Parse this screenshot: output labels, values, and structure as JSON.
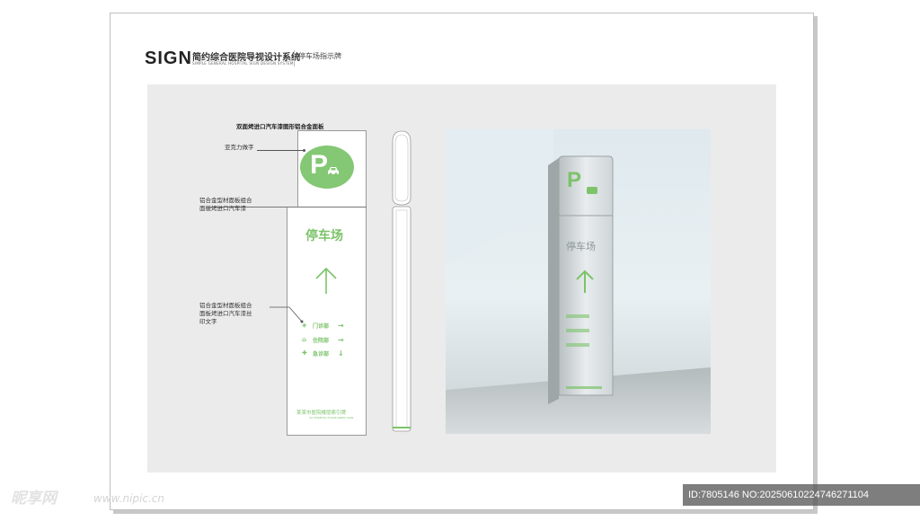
{
  "header": {
    "sign_word": "SIGN",
    "title_cn": "简约综合医院导视设计系统",
    "title_en": "SIMPLE GENERAL HOSPITAL SIGN DESIGN SYSTEM",
    "subtitle": "停车场指示牌"
  },
  "drawing": {
    "title": "双面烤进口汽车漆图形铝合金面板",
    "p_letter": "P",
    "main_text": "停车场",
    "directions": [
      {
        "icon": "outpatient-icon",
        "label": "门诊部",
        "arrow": "→"
      },
      {
        "icon": "inpatient-icon",
        "label": "住院部",
        "arrow": "→"
      },
      {
        "icon": "emergency-icon",
        "label": "急诊部",
        "arrow": "↓"
      }
    ],
    "footer_cn": "某某市医院楼层索引牌",
    "footer_en": "XX HOSPITAL FLOOR INDEX SIGN",
    "annotations": {
      "acrylic": "亚克力做字",
      "panel_line1": "铝合金型材面板组合",
      "panel_line2": "面板烤进口汽车漆",
      "print_line1": "铝合金型材面板组合",
      "print_line2": "面板烤进口汽车漆丝",
      "print_line3": "印文字"
    }
  },
  "colors": {
    "accent": "#7cc36a",
    "board": "#ebebeb"
  },
  "watermark": {
    "brand": "昵享网",
    "url": "www.nipic.cn"
  },
  "image_id": "ID:7805146 NO:20250610224746271104"
}
